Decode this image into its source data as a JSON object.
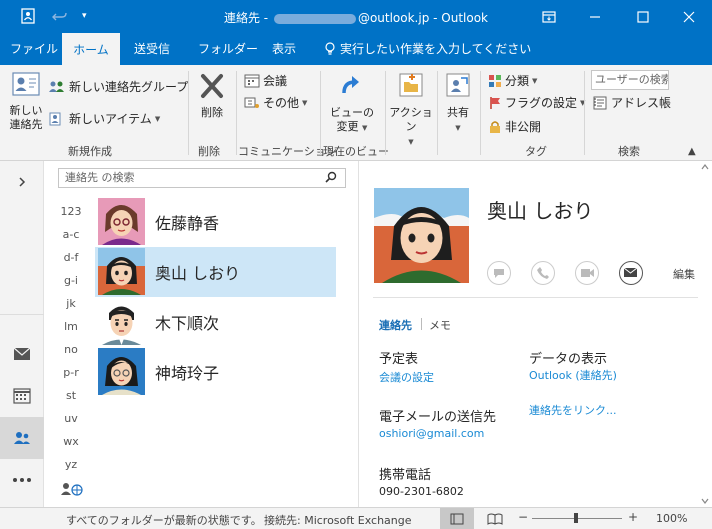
{
  "titlebar": {
    "title_prefix": "連絡先 - ",
    "title_suffix": "@outlook.jp - Outlook"
  },
  "tabs": [
    "ファイル",
    "ホーム",
    "送受信",
    "フォルダー",
    "表示"
  ],
  "tell_me": "実行したい作業を入力してください",
  "ribbon": {
    "new_contact": "新しい\n連絡先",
    "new_group": "新しい連絡先グループ",
    "new_items": "新しいアイテム",
    "group_new": "新規作成",
    "delete": "削除",
    "group_delete": "削除",
    "meeting": "会議",
    "more": "その他",
    "group_comm": "コミュニケーション",
    "change_view": "ビューの\n変更",
    "group_view": "現在のビュー",
    "actions": "アクション",
    "share": "共有",
    "categorize": "分類",
    "follow_up": "フラグの設定",
    "private": "非公開",
    "group_tags": "タグ",
    "search_people": "ユーザーの検索",
    "address_book": "アドレス帳",
    "group_find": "検索"
  },
  "list": {
    "search_placeholder": "連絡先 の検索",
    "alpha": [
      "123",
      "a-c",
      "d-f",
      "g-i",
      "jk",
      "lm",
      "no",
      "p-r",
      "st",
      "uv",
      "wx",
      "yz"
    ],
    "contacts": [
      "佐藤静香",
      "奥山 しおり",
      "木下順次",
      "神埼玲子"
    ]
  },
  "detail": {
    "name": "奥山 しおり",
    "hire": "編集",
    "tab_contact": "連絡先",
    "tab_notes": "メモ",
    "schedule_label": "予定表",
    "schedule_link": "会議の設定",
    "data_label": "データの表示",
    "data_link": "Outlook (連絡先)",
    "link_contacts": "連絡先をリンク...",
    "email_label": "電子メールの送信先",
    "email_value": "oshiori@gmail.com",
    "mobile_label": "携帯電話",
    "mobile_value": "090-2301-6802"
  },
  "status": {
    "sync": "すべてのフォルダーが最新の状態です。",
    "connection": "接続先: Microsoft Exchange",
    "zoom": "100%"
  },
  "colors": {
    "accent": "#0072c6",
    "selected_row": "#cde6f7",
    "link": "#1a8ad4"
  }
}
